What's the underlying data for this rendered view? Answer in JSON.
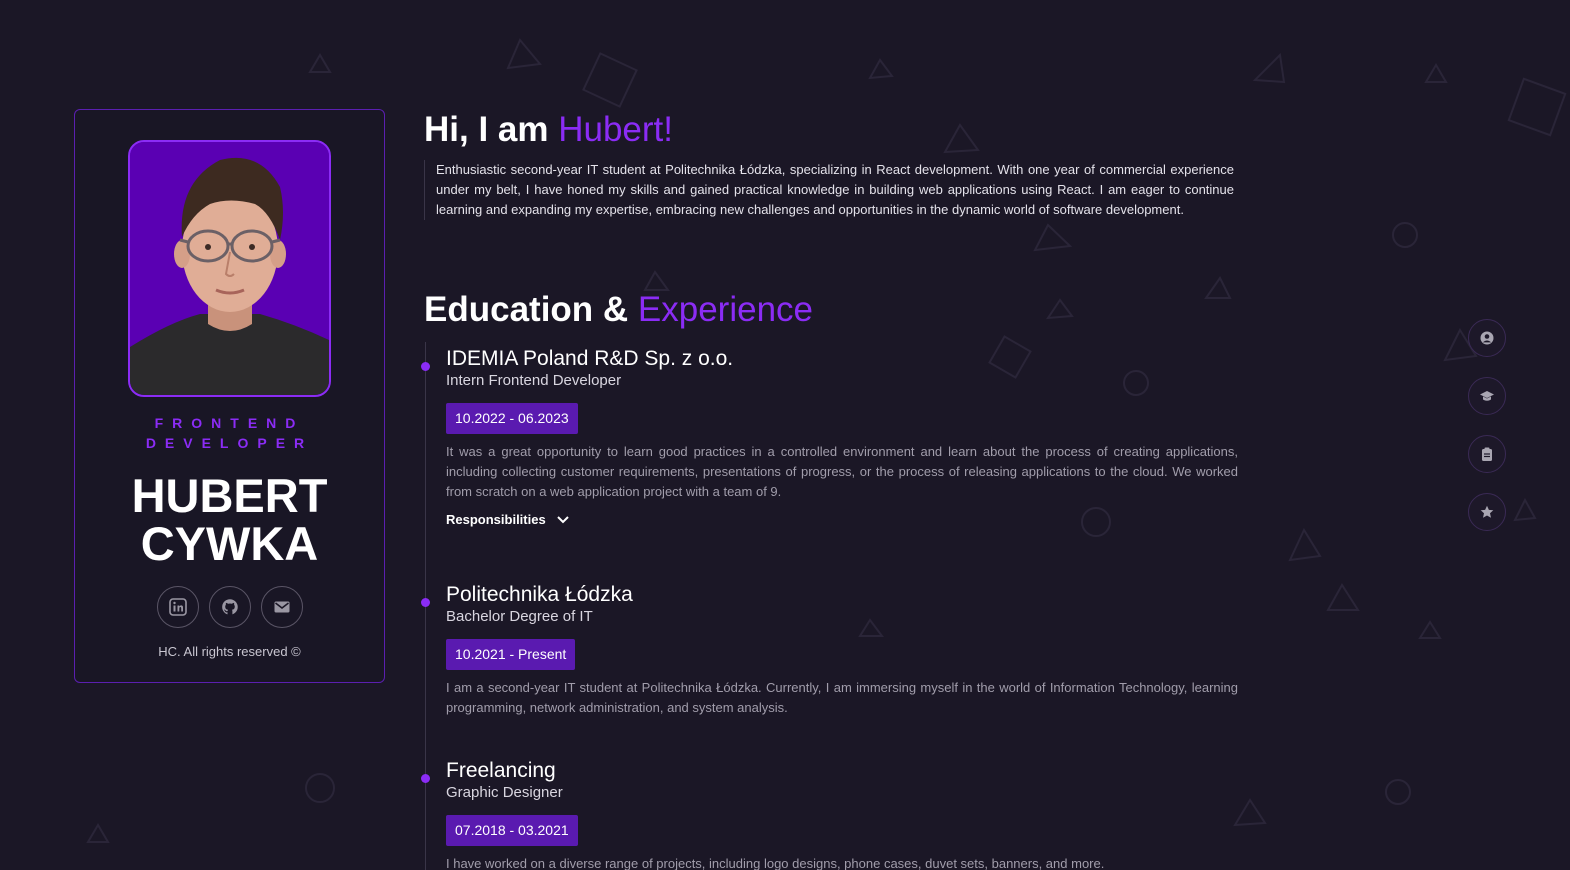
{
  "profile": {
    "role_line1": "FRONTEND",
    "role_line2": "DEVELOPER",
    "name_line1": "HUBERT",
    "name_line2": "CYWKA",
    "copyright": "HC. All rights reserved ©",
    "socials": [
      "linkedin-icon",
      "github-icon",
      "mail-icon"
    ]
  },
  "hero": {
    "greeting": "Hi, I am ",
    "name": "Hubert!",
    "about": "Enthusiastic second-year IT student at Politechnika Łódzka, specializing in React development. With one year of commercial experience under my belt, I have honed my skills and gained practical knowledge in building web applications using React. I am eager to continue learning and expanding my expertise, embracing new challenges and opportunities in the dynamic world of software development."
  },
  "education": {
    "title_part1": "Education & ",
    "title_part2": "Experience",
    "entries": [
      {
        "title": "IDEMIA Poland R&D Sp. z o.o.",
        "subtitle": "Intern Frontend Developer",
        "date": "10.2022 - 06.2023",
        "description": "It was a great opportunity to learn good practices in a controlled environment and learn about the process of creating applications, including collecting customer requirements, presentations of progress, or the process of releasing applications to the cloud. We worked from scratch on a web application project with a team of 9.",
        "responsibilities_label": "Responsibilities"
      },
      {
        "title": "Politechnika Łódzka",
        "subtitle": "Bachelor Degree of IT",
        "date": "10.2021 - Present",
        "description": "I am a second-year IT student at Politechnika Łódzka. Currently, I am immersing myself in the world of Information Technology, learning programming, network administration, and system analysis."
      },
      {
        "title": "Freelancing",
        "subtitle": "Graphic Designer",
        "date": "07.2018 - 03.2021",
        "description": "I have worked on a diverse range of projects, including logo designs, phone cases, duvet sets, banners, and more."
      }
    ]
  },
  "side_nav": [
    "user-icon",
    "graduation-cap-icon",
    "clipboard-icon",
    "star-icon"
  ],
  "colors": {
    "background": "#1b1726",
    "accent": "#8b2cf5",
    "badge": "#5a1ab0",
    "photo_bg": "#5a00b3"
  }
}
